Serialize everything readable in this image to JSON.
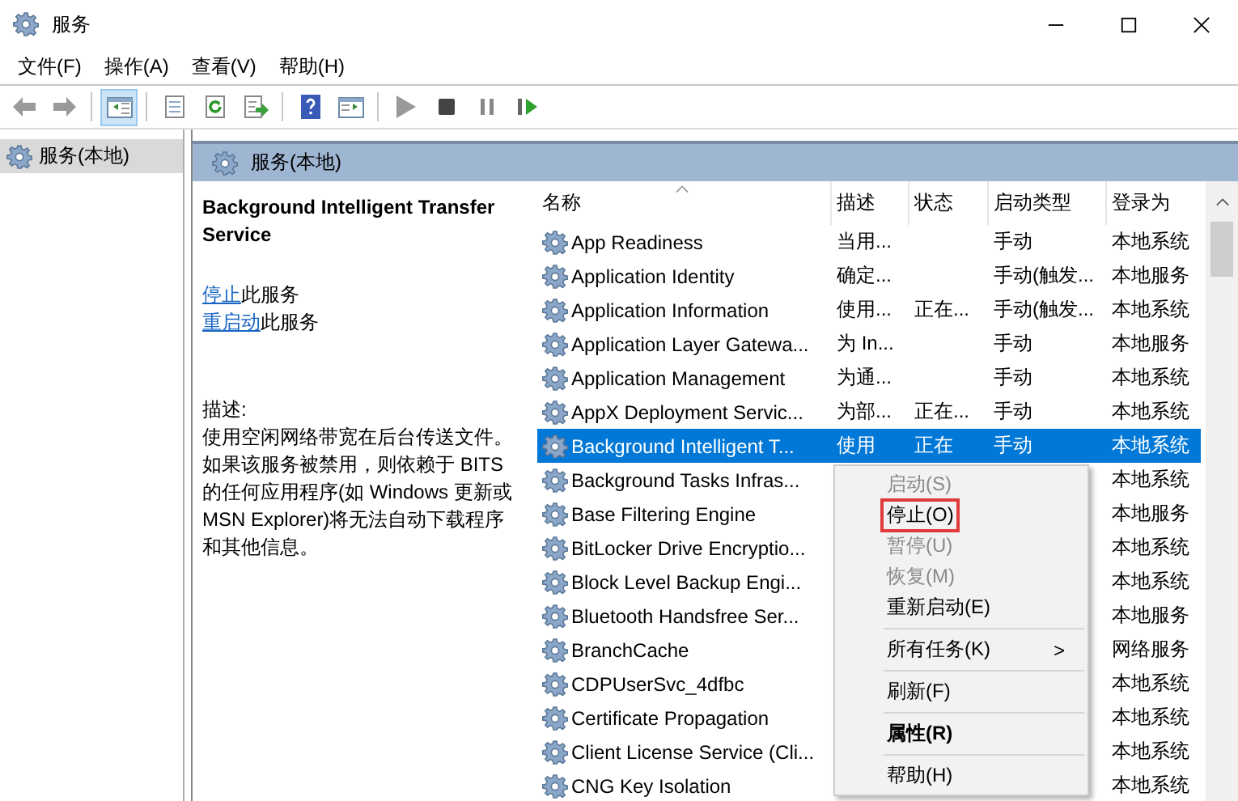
{
  "window": {
    "title": "服务"
  },
  "menu": [
    "文件(F)",
    "操作(A)",
    "查看(V)",
    "帮助(H)"
  ],
  "toolbar": [
    {
      "kind": "back",
      "selected": false
    },
    {
      "kind": "forward",
      "selected": false
    },
    {
      "kind": "sep"
    },
    {
      "kind": "tree",
      "selected": true
    },
    {
      "kind": "sep"
    },
    {
      "kind": "list",
      "selected": false
    },
    {
      "kind": "refresh",
      "selected": false
    },
    {
      "kind": "export",
      "selected": false
    },
    {
      "kind": "sep"
    },
    {
      "kind": "help",
      "selected": false
    },
    {
      "kind": "panel",
      "selected": false
    },
    {
      "kind": "sep"
    },
    {
      "kind": "play",
      "selected": false
    },
    {
      "kind": "stop",
      "selected": false
    },
    {
      "kind": "pause",
      "selected": false
    },
    {
      "kind": "resume",
      "selected": false
    }
  ],
  "tree": [
    {
      "label": "服务(本地)",
      "selected": true
    }
  ],
  "pane_header": "服务(本地)",
  "details": {
    "title": "Background Intelligent Transfer Service",
    "actions": [
      {
        "link": "停止",
        "text": "此服务"
      },
      {
        "link": "重启动",
        "text": "此服务"
      }
    ],
    "description_label": "描述:",
    "description": "使用空闲网络带宽在后台传送文件。如果该服务被禁用，则依赖于 BITS 的任何应用程序(如 Windows 更新或 MSN Explorer)将无法自动下载程序和其他信息。"
  },
  "table": {
    "columns": [
      "名称",
      "描述",
      "状态",
      "启动类型",
      "登录为"
    ],
    "rows": [
      {
        "name": "App Readiness",
        "description": "当用...",
        "status": "",
        "startup": "手动",
        "logon": "本地系统",
        "selected": false
      },
      {
        "name": "Application Identity",
        "description": "确定...",
        "status": "",
        "startup": "手动(触发...",
        "logon": "本地服务",
        "selected": false
      },
      {
        "name": "Application Information",
        "description": "使用...",
        "status": "正在...",
        "startup": "手动(触发...",
        "logon": "本地系统",
        "selected": false
      },
      {
        "name": "Application Layer Gatewa...",
        "description": "为 In...",
        "status": "",
        "startup": "手动",
        "logon": "本地服务",
        "selected": false
      },
      {
        "name": "Application Management",
        "description": "为通...",
        "status": "",
        "startup": "手动",
        "logon": "本地系统",
        "selected": false
      },
      {
        "name": "AppX Deployment Servic...",
        "description": "为部...",
        "status": "正在...",
        "startup": "手动",
        "logon": "本地系统",
        "selected": false
      },
      {
        "name": "Background Intelligent T...",
        "description": "使用",
        "status": "正在",
        "startup": "手动",
        "logon": "本地系统",
        "selected": true
      },
      {
        "name": "Background Tasks Infras...",
        "logon": "本地系统",
        "selected": false
      },
      {
        "name": "Base Filtering Engine",
        "logon": "本地服务",
        "selected": false
      },
      {
        "name": "BitLocker Drive Encryptio...",
        "logon": "本地系统",
        "selected": false
      },
      {
        "name": "Block Level Backup Engi...",
        "logon": "本地系统",
        "selected": false
      },
      {
        "name": "Bluetooth Handsfree Ser...",
        "logon": "本地服务",
        "selected": false
      },
      {
        "name": "BranchCache",
        "logon": "网络服务",
        "selected": false
      },
      {
        "name": "CDPUserSvc_4dfbc",
        "logon": "本地系统",
        "selected": false
      },
      {
        "name": "Certificate Propagation",
        "logon": "本地系统",
        "selected": false
      },
      {
        "name": "Client License Service (Cli...",
        "logon": "本地系统",
        "selected": false
      },
      {
        "name": "CNG Key Isolation",
        "logon": "本地系统",
        "selected": false
      }
    ]
  },
  "context_menu": [
    {
      "kind": "item",
      "label": "启动(S)",
      "disabled": true,
      "highlighted": false
    },
    {
      "kind": "item",
      "label": "停止(O)",
      "disabled": false,
      "highlighted": true
    },
    {
      "kind": "item",
      "label": "暂停(U)",
      "disabled": true,
      "highlighted": false
    },
    {
      "kind": "item",
      "label": "恢复(M)",
      "disabled": true,
      "highlighted": false
    },
    {
      "kind": "item",
      "label": "重新启动(E)",
      "disabled": false,
      "highlighted": false
    },
    {
      "kind": "sep"
    },
    {
      "kind": "submenu",
      "label": "所有任务(K)",
      "arrow": ">",
      "disabled": false,
      "highlighted": false
    },
    {
      "kind": "sep"
    },
    {
      "kind": "item",
      "label": "刷新(F)",
      "disabled": false,
      "highlighted": false
    },
    {
      "kind": "sep"
    },
    {
      "kind": "bold",
      "label": "属性(R)",
      "disabled": false,
      "highlighted": false
    },
    {
      "kind": "sep"
    },
    {
      "kind": "item",
      "label": "帮助(H)",
      "disabled": false,
      "highlighted": false
    }
  ]
}
